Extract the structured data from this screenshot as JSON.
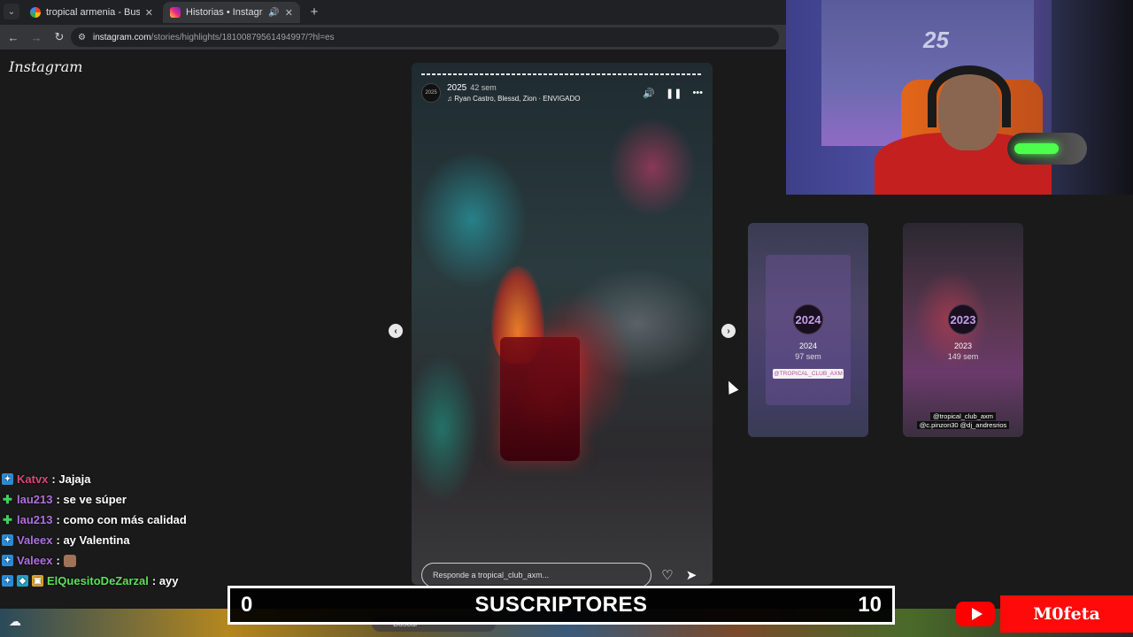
{
  "browser": {
    "tabs": [
      {
        "title": "tropical armenia - Buscar con G",
        "favicon": "google-icon",
        "active": false
      },
      {
        "title": "Historias • Instagram",
        "favicon": "instagram-icon",
        "active": true
      }
    ],
    "url_host": "instagram.com",
    "url_path": "/stories/highlights/18100879561494997/?hl=es"
  },
  "instagram": {
    "logo": "Instagram",
    "story": {
      "account_avatar_text": "2025",
      "title": "2025",
      "time": "42 sem",
      "music": "Ryan Castro, Blessd, Zion · ENVIGADO",
      "reply_placeholder": "Responde a tropical_club_axm..."
    },
    "highlights": [
      {
        "circle": "2024",
        "title": "2024",
        "time": "97 sem",
        "tag": "@TROPICAL_CLUB_AXM"
      },
      {
        "circle": "2023",
        "title": "2023",
        "time": "149 sem",
        "tags": [
          "@tropical_club_axm",
          "@c.pinzon30 @dj_andresrios"
        ]
      }
    ]
  },
  "chat": [
    {
      "user": "Katvx",
      "user_color": "#e0457b",
      "message": ": Jajaja",
      "badges": [
        "blue"
      ]
    },
    {
      "user": "lau213",
      "user_color": "#b06fe0",
      "message": ": se ve súper",
      "badges": [
        "green"
      ]
    },
    {
      "user": "lau213",
      "user_color": "#b06fe0",
      "message": ": como con más calidad",
      "badges": [
        "green"
      ]
    },
    {
      "user": "Valeex",
      "user_color": "#b06fe0",
      "message": ": ay Valentina",
      "badges": [
        "blue"
      ]
    },
    {
      "user": "Valeex",
      "user_color": "#b06fe0",
      "message": ":",
      "badges": [
        "blue"
      ],
      "emote": true
    },
    {
      "user": "ElQuesitoDeZarzal",
      "user_color": "#5ee05a",
      "message": ": ayy",
      "badges": [
        "blue",
        "teal",
        "gold"
      ]
    }
  ],
  "overlay": {
    "subs_current": "0",
    "subs_label": "SUSCRIPTORES",
    "subs_goal": "10",
    "channel_name": "M0feta"
  },
  "taskbar": {
    "search_placeholder": "Buscar"
  }
}
